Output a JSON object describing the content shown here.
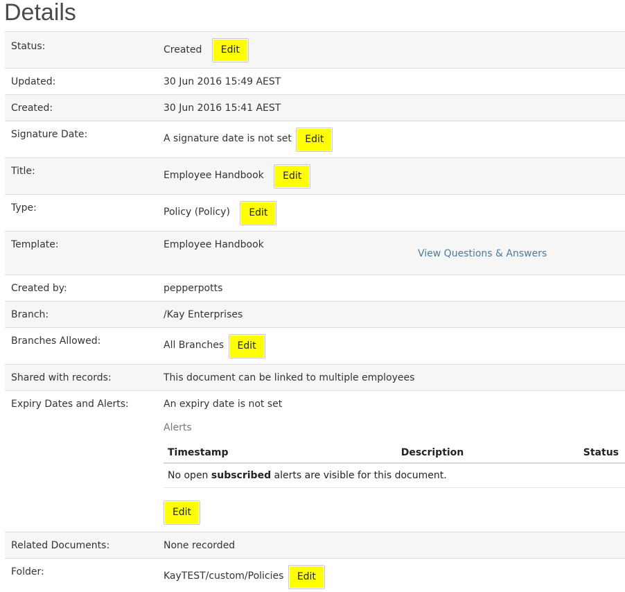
{
  "page": {
    "title": "Details"
  },
  "edit_label": "Edit",
  "rows": {
    "status": {
      "label": "Status:",
      "value": "Created"
    },
    "updated": {
      "label": "Updated:",
      "value": "30 Jun 2016 15:49 AEST"
    },
    "created": {
      "label": "Created:",
      "value": "30 Jun 2016 15:41 AEST"
    },
    "signature_date": {
      "label": "Signature Date:",
      "value": "A signature date is not set"
    },
    "title": {
      "label": "Title:",
      "value": "Employee Handbook"
    },
    "type": {
      "label": "Type:",
      "value": "Policy (Policy)"
    },
    "template": {
      "label": "Template:",
      "value": "Employee Handbook",
      "link": "View Questions & Answers"
    },
    "created_by": {
      "label": "Created by:",
      "value": "pepperpotts"
    },
    "branch": {
      "label": "Branch:",
      "value": "/Kay Enterprises"
    },
    "branches_allowed": {
      "label": "Branches Allowed:",
      "value": "All Branches"
    },
    "shared": {
      "label": "Shared with records:",
      "value": "This document can be linked to multiple employees"
    },
    "expiry": {
      "label": "Expiry Dates and Alerts:",
      "value": "An expiry date is not set",
      "alerts_heading": "Alerts",
      "columns": {
        "timestamp": "Timestamp",
        "description": "Description",
        "status": "Status"
      },
      "empty_prefix": "No open ",
      "empty_bold": "subscribed",
      "empty_suffix": " alerts are visible for this document."
    },
    "related": {
      "label": "Related Documents:",
      "value": "None recorded"
    },
    "folder": {
      "label": "Folder:",
      "value": "KayTEST/custom/Policies"
    }
  },
  "colors": {
    "edit_button": "#ffff00",
    "link": "#4d7a9a",
    "row_alt": "#f6f6f6",
    "border": "#dcdcdc"
  }
}
